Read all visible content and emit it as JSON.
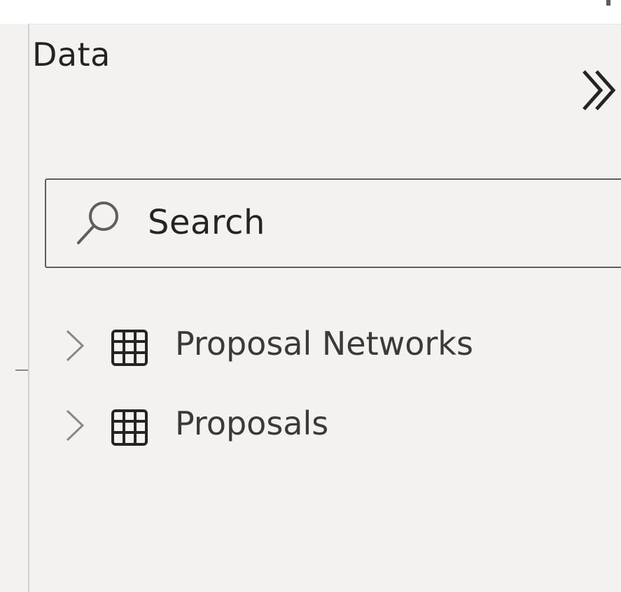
{
  "pane": {
    "title": "Data",
    "collapse_icon": "double-chevron-right-icon"
  },
  "search": {
    "placeholder": "Search",
    "icon": "search-icon"
  },
  "tables": [
    {
      "label": "Proposal Networks",
      "expand_icon": "chevron-right-icon",
      "type_icon": "table-icon"
    },
    {
      "label": "Proposals",
      "expand_icon": "chevron-right-icon",
      "type_icon": "table-icon"
    }
  ],
  "colors": {
    "pane_background": "#f3f2f1",
    "text_primary": "#252423",
    "text_secondary": "#3b3a39",
    "border": "#605e5c",
    "icon": "#605e5c"
  }
}
